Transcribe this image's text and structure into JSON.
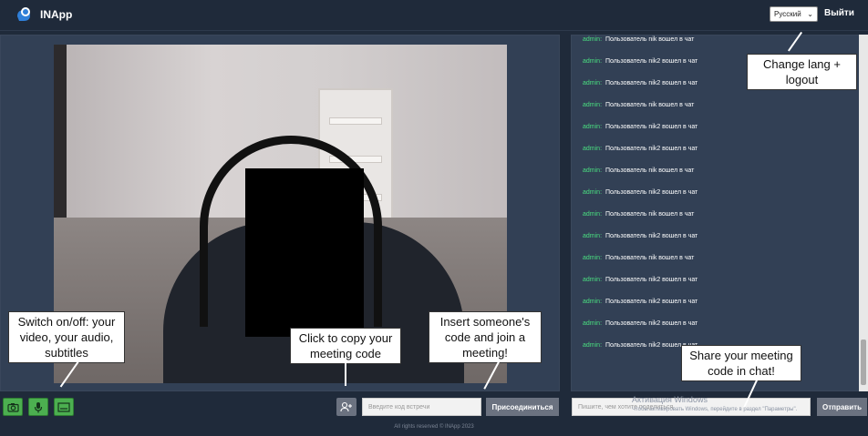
{
  "app": {
    "name": "INApp"
  },
  "header": {
    "language": "Русский",
    "logout_label": "Выйти"
  },
  "controls": {
    "camera_icon": "camera-icon",
    "mic_icon": "microphone-icon",
    "subtitles_icon": "subtitles-icon",
    "copy_icon": "add-person-icon",
    "code_placeholder": "Введите код встречи",
    "join_label": "Присоединиться"
  },
  "chat": {
    "messages": [
      {
        "author": "admin:",
        "text": "Пользователь nik вошел в чат"
      },
      {
        "author": "admin:",
        "text": "Пользователь nik2 вошел в чат"
      },
      {
        "author": "admin:",
        "text": "Пользователь nik2 вошел в чат"
      },
      {
        "author": "admin:",
        "text": "Пользователь nik вошел в чат"
      },
      {
        "author": "admin:",
        "text": "Пользователь nik2 вошел в чат"
      },
      {
        "author": "admin:",
        "text": "Пользователь nik2 вошел в чат"
      },
      {
        "author": "admin:",
        "text": "Пользователь nik вошел в чат"
      },
      {
        "author": "admin:",
        "text": "Пользователь nik2 вошел в чат"
      },
      {
        "author": "admin:",
        "text": "Пользователь nik вошел в чат"
      },
      {
        "author": "admin:",
        "text": "Пользователь nik2 вошел в чат"
      },
      {
        "author": "admin:",
        "text": "Пользователь nik вошел в чат"
      },
      {
        "author": "admin:",
        "text": "Пользователь nik2 вошел в чат"
      },
      {
        "author": "admin:",
        "text": "Пользователь nik2 вошел в чат"
      },
      {
        "author": "admin:",
        "text": "Пользователь nik2 вошел в чат"
      },
      {
        "author": "admin:",
        "text": "Пользователь nik2 вошел в чат"
      }
    ],
    "input_placeholder": "Пишите, чем хотите поделиться",
    "send_label": "Отправить"
  },
  "watermark": {
    "title": "Активация Windows",
    "subtitle": "Чтобы активировать Windows, перейдите в раздел \"Параметры\"."
  },
  "footer": "All rights reserved © INApp 2023",
  "callouts": {
    "lang": "Change lang + logout",
    "controls": "Switch on/off: your video, your audio, subtitles",
    "copy": "Click to copy your meeting code",
    "join": "Insert someone's code and join a meeting!",
    "chat": "Share your meeting code in chat!"
  }
}
